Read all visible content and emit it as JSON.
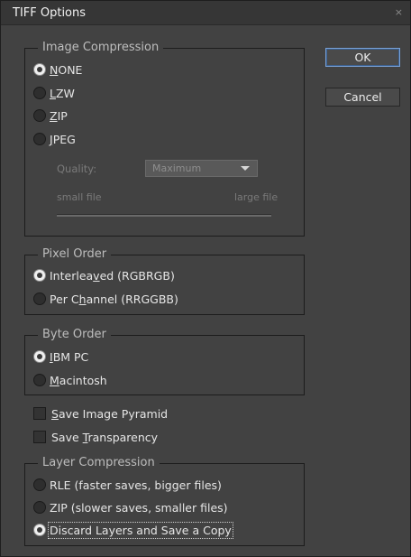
{
  "window": {
    "title": "TIFF Options",
    "close_glyph": "×"
  },
  "buttons": {
    "ok": "OK",
    "cancel": "Cancel"
  },
  "image_compression": {
    "legend": "Image Compression",
    "options": [
      "NONE",
      "LZW",
      "ZIP",
      "JPEG"
    ],
    "selected": "NONE",
    "quality_label": "Quality:",
    "quality_value": "Maximum",
    "small_file": "small file",
    "large_file": "large file"
  },
  "pixel_order": {
    "legend": "Pixel Order",
    "options": [
      "Interleaved (RGBRGB)",
      "Per Channel (RRGGBB)"
    ],
    "selected": "Interleaved (RGBRGB)"
  },
  "byte_order": {
    "legend": "Byte Order",
    "options": [
      "IBM PC",
      "Macintosh"
    ],
    "selected": "IBM PC"
  },
  "checkboxes": {
    "save_image_pyramid": {
      "label": "Save Image Pyramid",
      "checked": false
    },
    "save_transparency": {
      "label": "Save Transparency",
      "checked": false
    }
  },
  "layer_compression": {
    "legend": "Layer Compression",
    "options": [
      "RLE (faster saves, bigger files)",
      "ZIP (slower saves, smaller files)",
      "Discard Layers and Save a Copy"
    ],
    "selected": "Discard Layers and Save a Copy"
  }
}
